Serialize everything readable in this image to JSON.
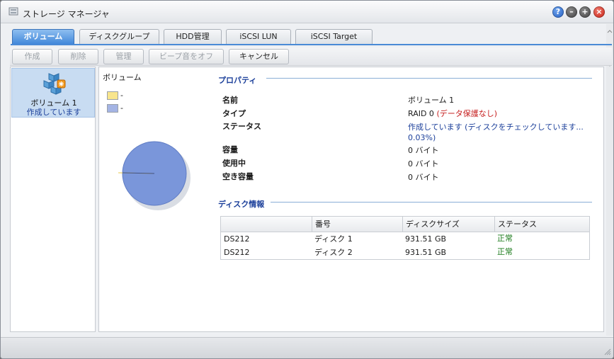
{
  "window": {
    "title": "ストレージ マネージャ"
  },
  "tabs": [
    {
      "label": "ボリューム",
      "active": true
    },
    {
      "label": "ディスクグループ"
    },
    {
      "label": "HDD管理"
    },
    {
      "label": "iSCSI LUN"
    },
    {
      "label": "iSCSI Target"
    }
  ],
  "toolbar": {
    "create": "作成",
    "delete": "削除",
    "manage": "管理",
    "beep_off": "ビープ音をオフ",
    "cancel": "キャンセル"
  },
  "sidebar": {
    "items": [
      {
        "name": "ボリューム 1",
        "status": "作成しています"
      }
    ]
  },
  "chart": {
    "title": "ボリューム",
    "legend": [
      {
        "label": "-",
        "color": "#f8e58c"
      },
      {
        "label": "-",
        "color": "#a4b4e4"
      }
    ],
    "pie_color": "#7a96da"
  },
  "properties": {
    "section_title": "プロパティ",
    "name_label": "名前",
    "name_value": "ボリューム 1",
    "type_label": "タイプ",
    "type_value": "RAID 0",
    "type_note": "(データ保護なし)",
    "status_label": "ステータス",
    "status_value_line1": "作成しています (ディスクをチェックしています...",
    "status_value_line2": "0.03%)",
    "capacity_label": "容量",
    "capacity_value": "0 バイト",
    "used_label": "使用中",
    "used_value": "0 バイト",
    "free_label": "空き容量",
    "free_value": "0 バイト"
  },
  "disk_info": {
    "section_title": "ディスク情報",
    "headers": [
      "",
      "番号",
      "ディスクサイズ",
      "ステータス"
    ],
    "rows": [
      [
        "DS212",
        "ディスク 1",
        "931.51 GB",
        "正常"
      ],
      [
        "DS212",
        "ディスク 2",
        "931.51 GB",
        "正常"
      ]
    ]
  },
  "colors": {
    "accent": "#4a8ad6",
    "ok": "#1a7a1a",
    "warning": "#c62020"
  }
}
